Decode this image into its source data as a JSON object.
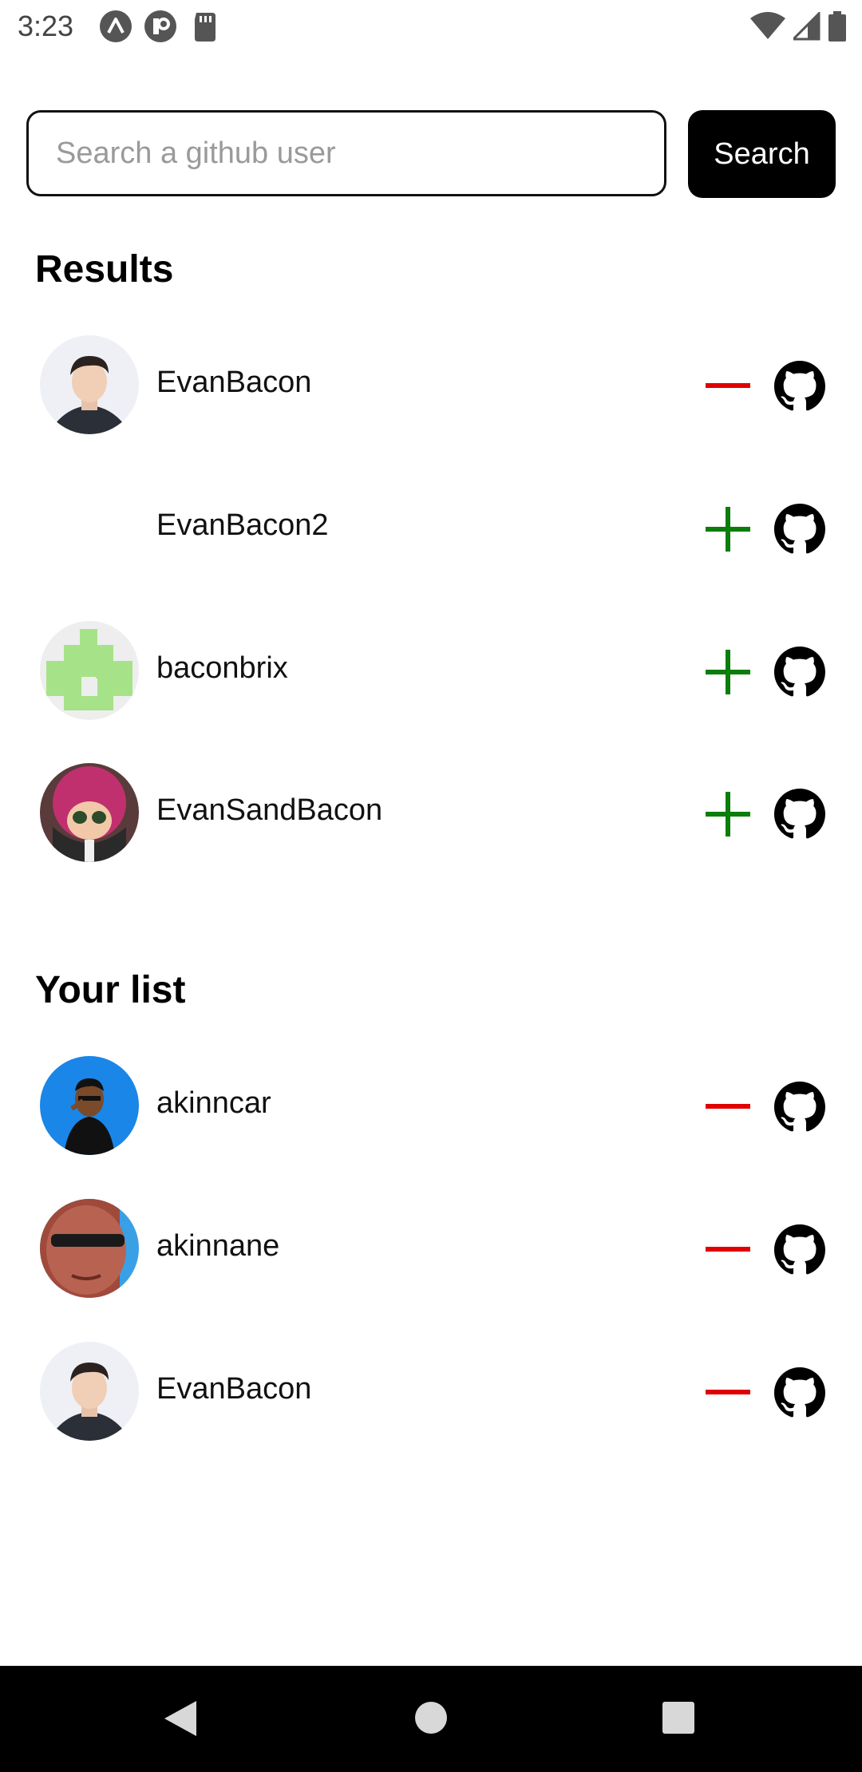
{
  "status_bar": {
    "time": "3:23"
  },
  "search": {
    "placeholder": "Search a github user",
    "value": "",
    "button_label": "Search"
  },
  "results": {
    "title": "Results",
    "items": [
      {
        "username": "EvanBacon",
        "action": "remove",
        "avatar": "evanbacon"
      },
      {
        "username": "EvanBacon2",
        "action": "add",
        "avatar": "none"
      },
      {
        "username": "baconbrix",
        "action": "add",
        "avatar": "identicon-green"
      },
      {
        "username": "EvanSandBacon",
        "action": "add",
        "avatar": "squid-pink"
      }
    ]
  },
  "your_list": {
    "title": "Your list",
    "items": [
      {
        "username": "akinncar",
        "action": "remove",
        "avatar": "blue-bg-person"
      },
      {
        "username": "akinnane",
        "action": "remove",
        "avatar": "sunglasses-man"
      },
      {
        "username": "EvanBacon",
        "action": "remove",
        "avatar": "evanbacon"
      }
    ]
  },
  "colors": {
    "remove": "#e00000",
    "add": "#0a7d0a",
    "button_bg": "#000000",
    "nav_bar": "#000000"
  },
  "icons": {
    "remove": "minus-icon",
    "add": "plus-icon",
    "github": "github-icon"
  }
}
